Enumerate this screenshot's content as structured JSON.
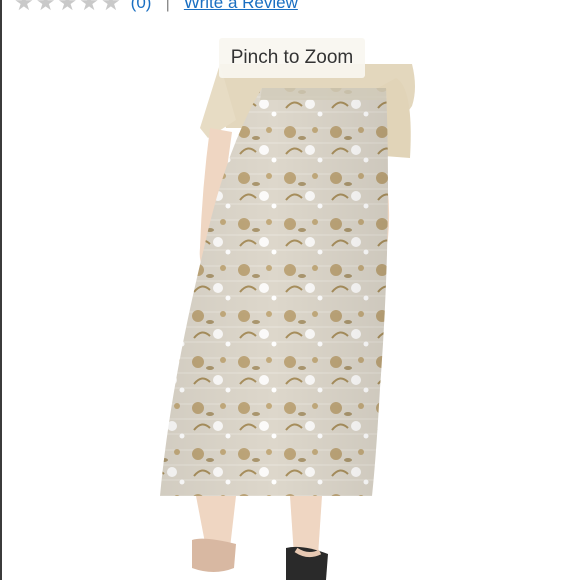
{
  "reviews": {
    "stars_filled": 0,
    "stars_total": 5,
    "count_text": "(0)",
    "separator": "|",
    "write_review_label": "Write a Review"
  },
  "image": {
    "zoom_hint": "Pinch to Zoom"
  },
  "colors": {
    "link": "#1a6fc2",
    "star_empty": "#c9c9c9",
    "skirt_base": "#ddd7cb",
    "floral_tan": "#b79c6b",
    "top_cream": "#e3d7bd",
    "skin": "#efd6c2"
  }
}
